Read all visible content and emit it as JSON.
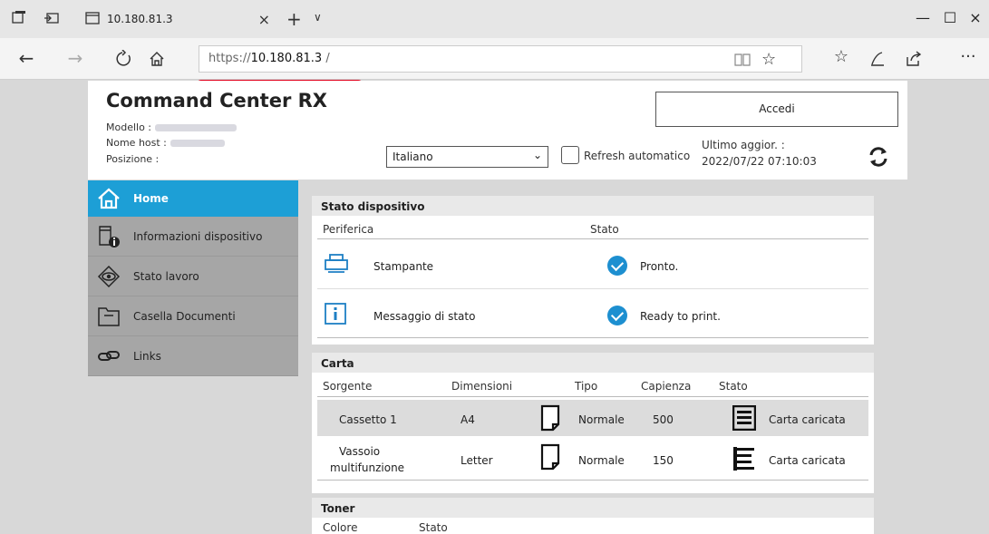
{
  "browser": {
    "tab_title": "10.180.81.3",
    "tab_close": "×",
    "new_tab": "+",
    "tab_dropdown": "∨",
    "url_prefix": "https://",
    "url_host": "10.180.81.3",
    "url_suffix": " /",
    "win_minimize": "—",
    "win_maximize": "☐",
    "win_close": "×",
    "more": "···"
  },
  "header": {
    "title": "Command Center RX",
    "model_label": "Modello :",
    "host_label": "Nome host :",
    "location_label": "Posizione :",
    "login_label": "Accedi",
    "language_value": "Italiano",
    "auto_refresh_label": "Refresh automatico",
    "last_update_label": "Ultimo aggior. :",
    "last_update_value": "2022/07/22 07:10:03"
  },
  "sidebar": {
    "items": [
      {
        "label": "Home",
        "active": true
      },
      {
        "label": "Informazioni dispositivo",
        "active": false
      },
      {
        "label": "Stato lavoro",
        "active": false
      },
      {
        "label": "Casella Documenti",
        "active": false
      },
      {
        "label": "Links",
        "active": false
      }
    ]
  },
  "device_status": {
    "title": "Stato dispositivo",
    "col_device": "Periferica",
    "col_status": "Stato",
    "rows": [
      {
        "device": "Stampante",
        "status": "Pronto."
      },
      {
        "device": "Messaggio di stato",
        "status": "Ready to print."
      }
    ]
  },
  "paper": {
    "title": "Carta",
    "columns": [
      "Sorgente",
      "Dimensioni",
      "Tipo",
      "Capienza",
      "Stato"
    ],
    "rows": [
      {
        "source": "Cassetto 1",
        "size": "A4",
        "type": "Normale",
        "capacity": "500",
        "status": "Carta caricata",
        "level": 1.0
      },
      {
        "source": "Vassoio multifunzione",
        "source_line1": "Vassoio",
        "source_line2": "multifunzione",
        "size": "Letter",
        "type": "Normale",
        "capacity": "150",
        "status": "Carta caricata",
        "level": 1.0
      }
    ]
  },
  "toner": {
    "title": "Toner",
    "columns": [
      "Colore",
      "Stato"
    ]
  }
}
